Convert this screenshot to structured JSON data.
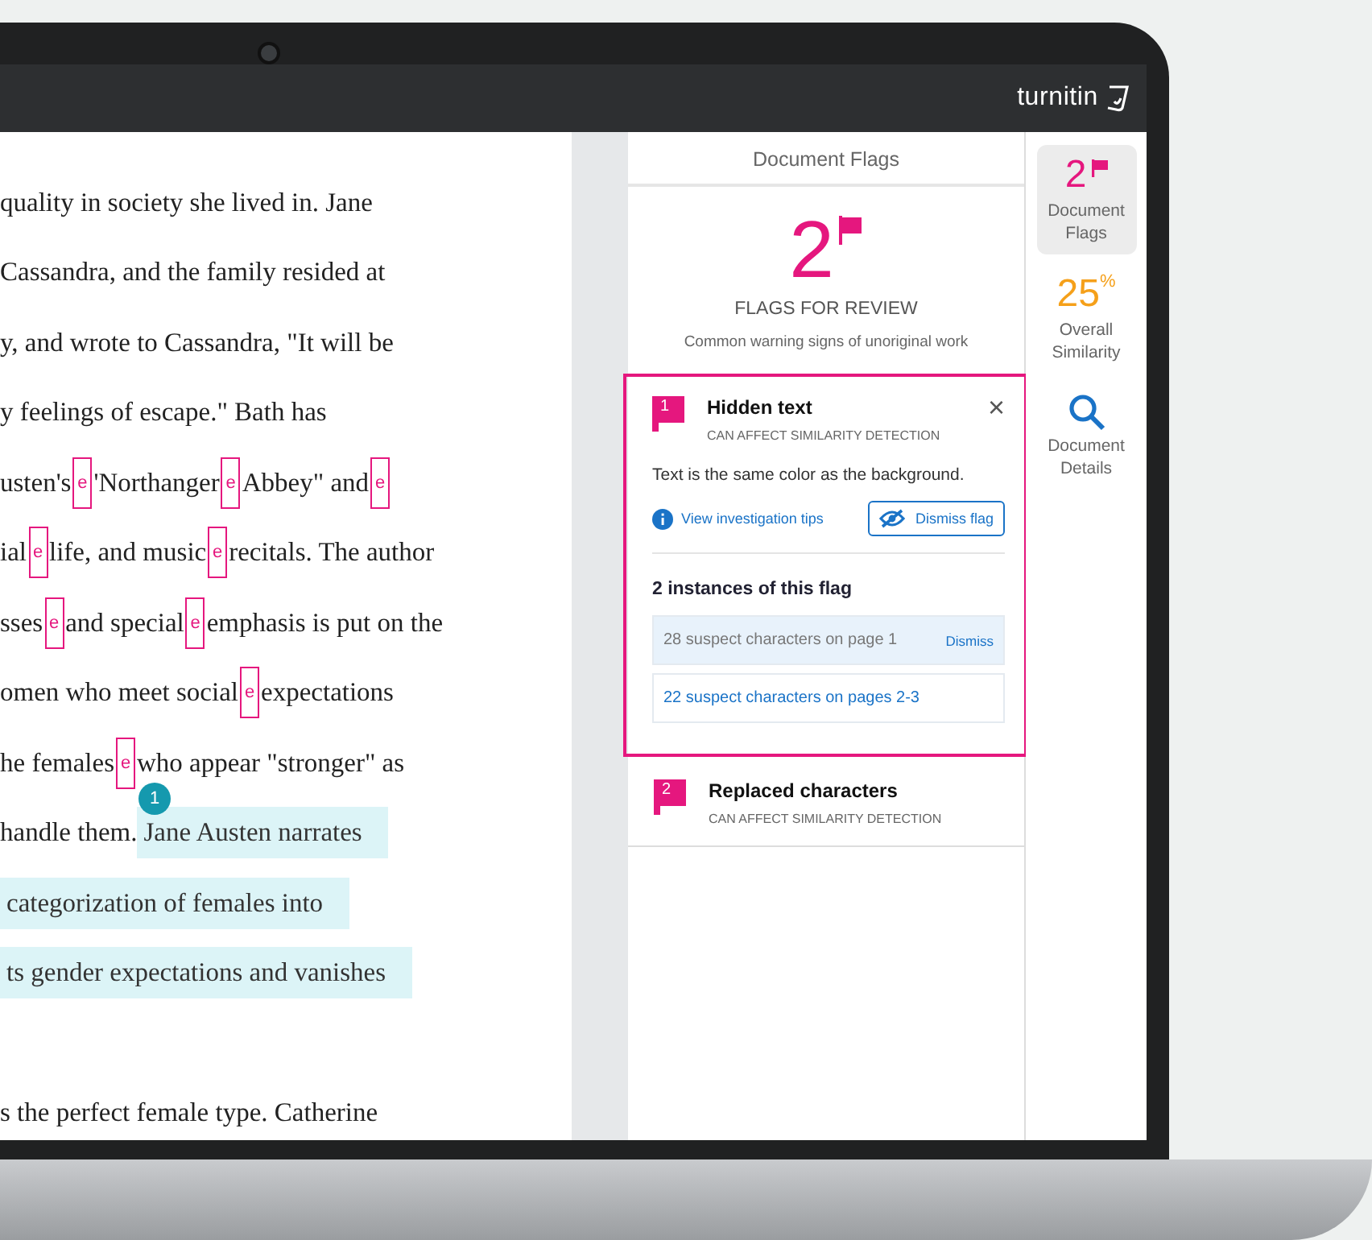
{
  "brand": {
    "logo": "turnitin"
  },
  "document": {
    "lines": [
      {
        "segments": [
          {
            "kind": "text",
            "text": "quality in society she lived in. Jane"
          }
        ]
      },
      {
        "segments": [
          {
            "kind": "text",
            "text": "Cassandra, and the family resided at"
          }
        ]
      },
      {
        "segments": [
          {
            "kind": "text",
            "text": "y, and wrote to Cassandra, \"It will be"
          }
        ]
      },
      {
        "segments": [
          {
            "kind": "text",
            "text": "y feelings of escape.\" Bath has"
          }
        ]
      },
      {
        "segments": [
          {
            "kind": "text",
            "text": "usten's"
          },
          {
            "kind": "hidden",
            "text": "e"
          },
          {
            "kind": "text",
            "text": "'Northanger"
          },
          {
            "kind": "hidden",
            "text": "e"
          },
          {
            "kind": "text",
            "text": "Abbey\" and"
          },
          {
            "kind": "hidden",
            "text": "e"
          }
        ]
      },
      {
        "segments": [
          {
            "kind": "text",
            "text": "ial"
          },
          {
            "kind": "hidden",
            "text": "e"
          },
          {
            "kind": "text",
            "text": "life, and music"
          },
          {
            "kind": "hidden",
            "text": "e"
          },
          {
            "kind": "text",
            "text": "recitals. The author"
          }
        ]
      },
      {
        "segments": [
          {
            "kind": "text",
            "text": "sses"
          },
          {
            "kind": "hidden",
            "text": "e"
          },
          {
            "kind": "text",
            "text": "and special"
          },
          {
            "kind": "hidden",
            "text": "e"
          },
          {
            "kind": "text",
            "text": "emphasis is put on the"
          }
        ]
      },
      {
        "segments": [
          {
            "kind": "text",
            "text": "omen who meet social"
          },
          {
            "kind": "hidden",
            "text": "e"
          },
          {
            "kind": "text",
            "text": "expectations"
          }
        ]
      },
      {
        "segments": [
          {
            "kind": "text",
            "text": "he females"
          },
          {
            "kind": "hidden",
            "text": "e"
          },
          {
            "kind": "text",
            "text": "who appear \"stronger\" as"
          }
        ],
        "marker": "1"
      },
      {
        "segments": [
          {
            "kind": "text",
            "text": "handle them."
          },
          {
            "kind": "highlight",
            "text": "Jane Austen narrates"
          }
        ]
      },
      {
        "segments": [
          {
            "kind": "highlight",
            "text": "categorization of females into"
          }
        ]
      },
      {
        "segments": [
          {
            "kind": "highlight",
            "text": "ts gender expectations and vanishes"
          }
        ]
      },
      {
        "gap_before": true,
        "segments": [
          {
            "kind": "text",
            "text": "s the perfect female type. Catherine"
          }
        ]
      }
    ]
  },
  "panel": {
    "title": "Document Flags",
    "count": "2",
    "count_label": "FLAGS FOR REVIEW",
    "subtitle": "Common warning signs of unoriginal work",
    "flags": [
      {
        "number": "1",
        "title": "Hidden text",
        "subtitle": "CAN AFFECT SIMILARITY DETECTION",
        "expanded": true,
        "close": "×",
        "description": "Text is the same color as the background.",
        "tips_link": "View investigation tips",
        "dismiss_button": "Dismiss flag",
        "instances_heading": "2 instances of this flag",
        "instances": [
          {
            "label": "28 suspect characters on page 1",
            "selected": true,
            "action": "Dismiss"
          },
          {
            "label": "22 suspect characters on pages 2-3",
            "selected": false
          }
        ]
      },
      {
        "number": "2",
        "title": "Replaced characters",
        "subtitle": "CAN AFFECT SIMILARITY DETECTION",
        "expanded": false
      }
    ]
  },
  "rail": [
    {
      "kind": "flags",
      "value": "2",
      "label": "Document Flags",
      "selected": true
    },
    {
      "kind": "similarity",
      "value": "25",
      "unit": "%",
      "label": "Overall Similarity",
      "selected": false
    },
    {
      "kind": "details",
      "label": "Document Details",
      "selected": false
    }
  ]
}
